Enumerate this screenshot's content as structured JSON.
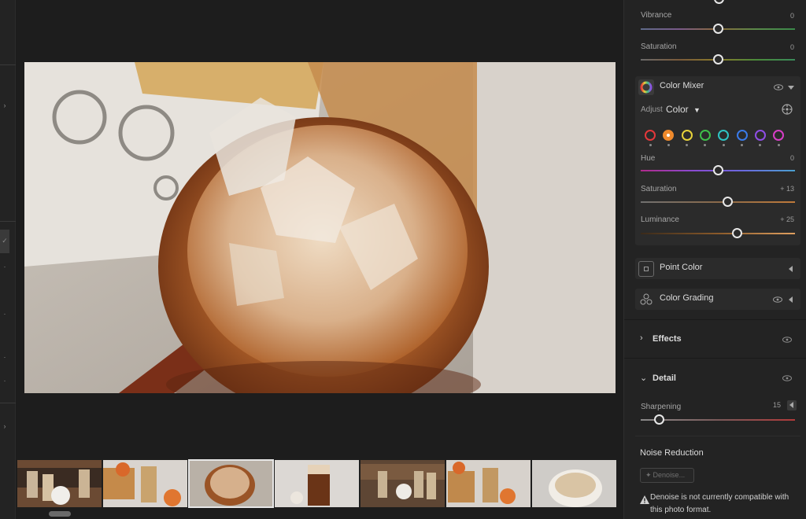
{
  "panel": {
    "vibrance": {
      "label": "Vibrance",
      "value": "0",
      "level": 0.5
    },
    "saturation_top": {
      "label": "Saturation",
      "value": "0",
      "level": 0.5
    },
    "color_mixer": {
      "title": "Color Mixer",
      "adjust_label": "Adjust",
      "adjust_value": "Color",
      "swatches": [
        "#e5383b",
        "#f08a2c",
        "#e7d23a",
        "#3fbf4a",
        "#2ec4c4",
        "#3a7bea",
        "#8f4ee6",
        "#d83ec7"
      ],
      "selected_swatch": 1,
      "hue": {
        "label": "Hue",
        "value": "0",
        "level": 0.5
      },
      "saturation": {
        "label": "Saturation",
        "value": "+ 13",
        "level": 0.565
      },
      "luminance": {
        "label": "Luminance",
        "value": "+ 25",
        "level": 0.625
      }
    },
    "point_color": {
      "title": "Point Color"
    },
    "color_grading": {
      "title": "Color Grading"
    },
    "effects": {
      "title": "Effects"
    },
    "detail": {
      "title": "Detail",
      "sharpening": {
        "label": "Sharpening",
        "value": "15",
        "level": 0.12
      },
      "noise_reduction": "Noise Reduction",
      "denoise_button": "Denoise...",
      "warning": "Denoise is not currently compatible with this photo format."
    }
  },
  "filmstrip": {
    "count": 7,
    "selected": 2
  },
  "icons": {
    "color_mixer": "color-wheel-icon",
    "target": "target-adjust-icon",
    "point_color": "point-color-icon",
    "color_grading": "color-grading-icon",
    "eye": "eye-icon",
    "warning": "warning-icon",
    "denoise": "sparkle-icon"
  },
  "colors": {
    "panel_bg": "#232323",
    "group_bg": "#2b2b2b",
    "accent": "#e8e8e8"
  }
}
